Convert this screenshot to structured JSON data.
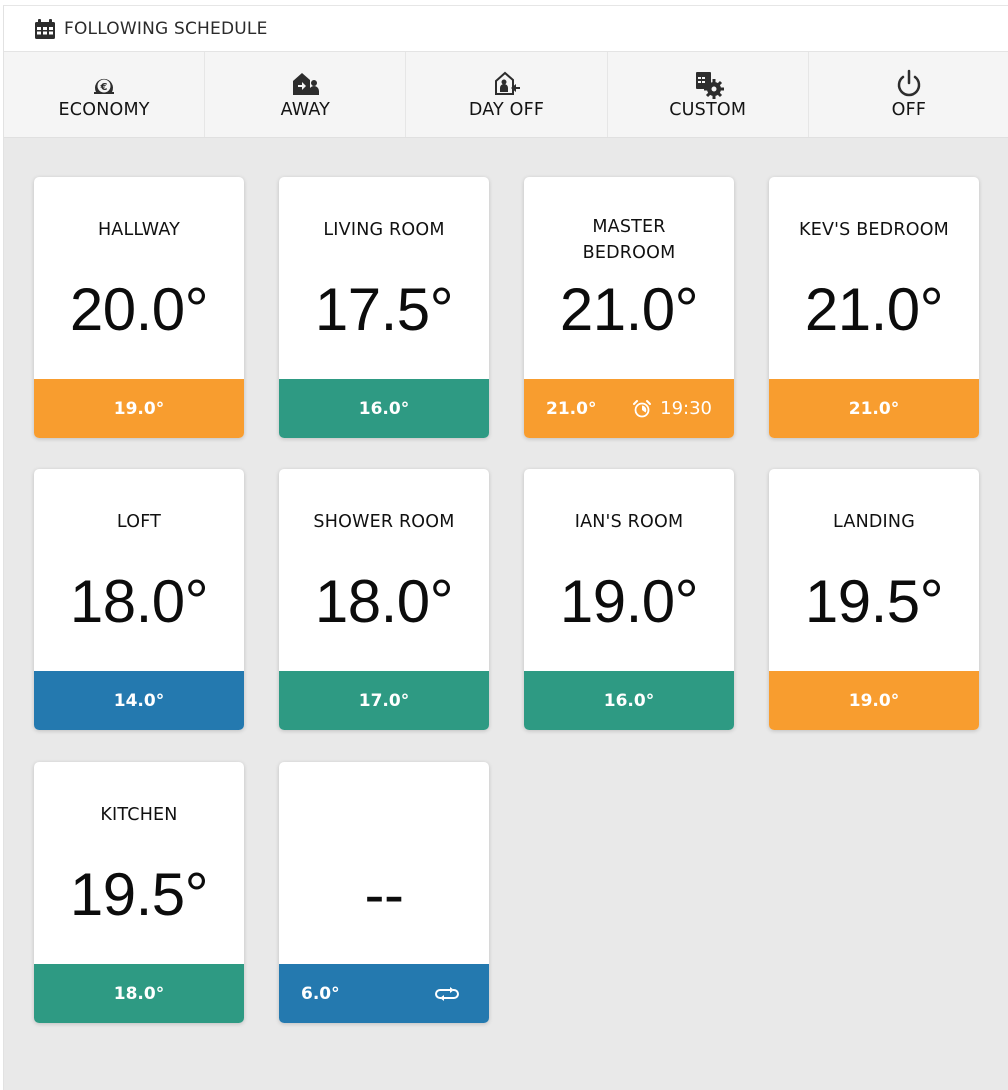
{
  "header": {
    "icon": "calendar-icon",
    "title": "FOLLOWING SCHEDULE"
  },
  "modes": [
    {
      "label": "ECONOMY",
      "icon": "economy-euro-icon"
    },
    {
      "label": "AWAY",
      "icon": "away-house-person-icon"
    },
    {
      "label": "DAY OFF",
      "icon": "day-off-house-icon"
    },
    {
      "label": "CUSTOM",
      "icon": "custom-calendar-gear-icon"
    },
    {
      "label": "OFF",
      "icon": "power-icon"
    }
  ],
  "colors": {
    "heating": "#F89D2F",
    "satisfied": "#2E9A83",
    "cool": "#2479AF"
  },
  "zones": [
    {
      "name": "HALLWAY",
      "current": "20.0°",
      "target": "19.0°",
      "status": "heating"
    },
    {
      "name": "LIVING ROOM",
      "current": "17.5°",
      "target": "16.0°",
      "status": "satisfied"
    },
    {
      "name": "MASTER BEDROOM",
      "name_line1": "MASTER",
      "name_line2": "BEDROOM",
      "current": "21.0°",
      "target": "21.0°",
      "status": "heating",
      "timer_icon": "alarm-clock-icon",
      "timer": "19:30"
    },
    {
      "name": "KEV'S BEDROOM",
      "current": "21.0°",
      "target": "21.0°",
      "status": "heating"
    },
    {
      "name": "LOFT",
      "current": "18.0°",
      "target": "14.0°",
      "status": "cool"
    },
    {
      "name": "SHOWER ROOM",
      "current": "18.0°",
      "target": "17.0°",
      "status": "satisfied"
    },
    {
      "name": "IAN'S ROOM",
      "current": "19.0°",
      "target": "16.0°",
      "status": "satisfied"
    },
    {
      "name": "LANDING",
      "current": "19.5°",
      "target": "19.0°",
      "status": "heating"
    },
    {
      "name": "KITCHEN",
      "current": "19.5°",
      "target": "18.0°",
      "status": "satisfied"
    },
    {
      "name": "",
      "current": "--",
      "target": "6.0°",
      "status": "cool",
      "mode_icon": "repeat-icon"
    }
  ]
}
